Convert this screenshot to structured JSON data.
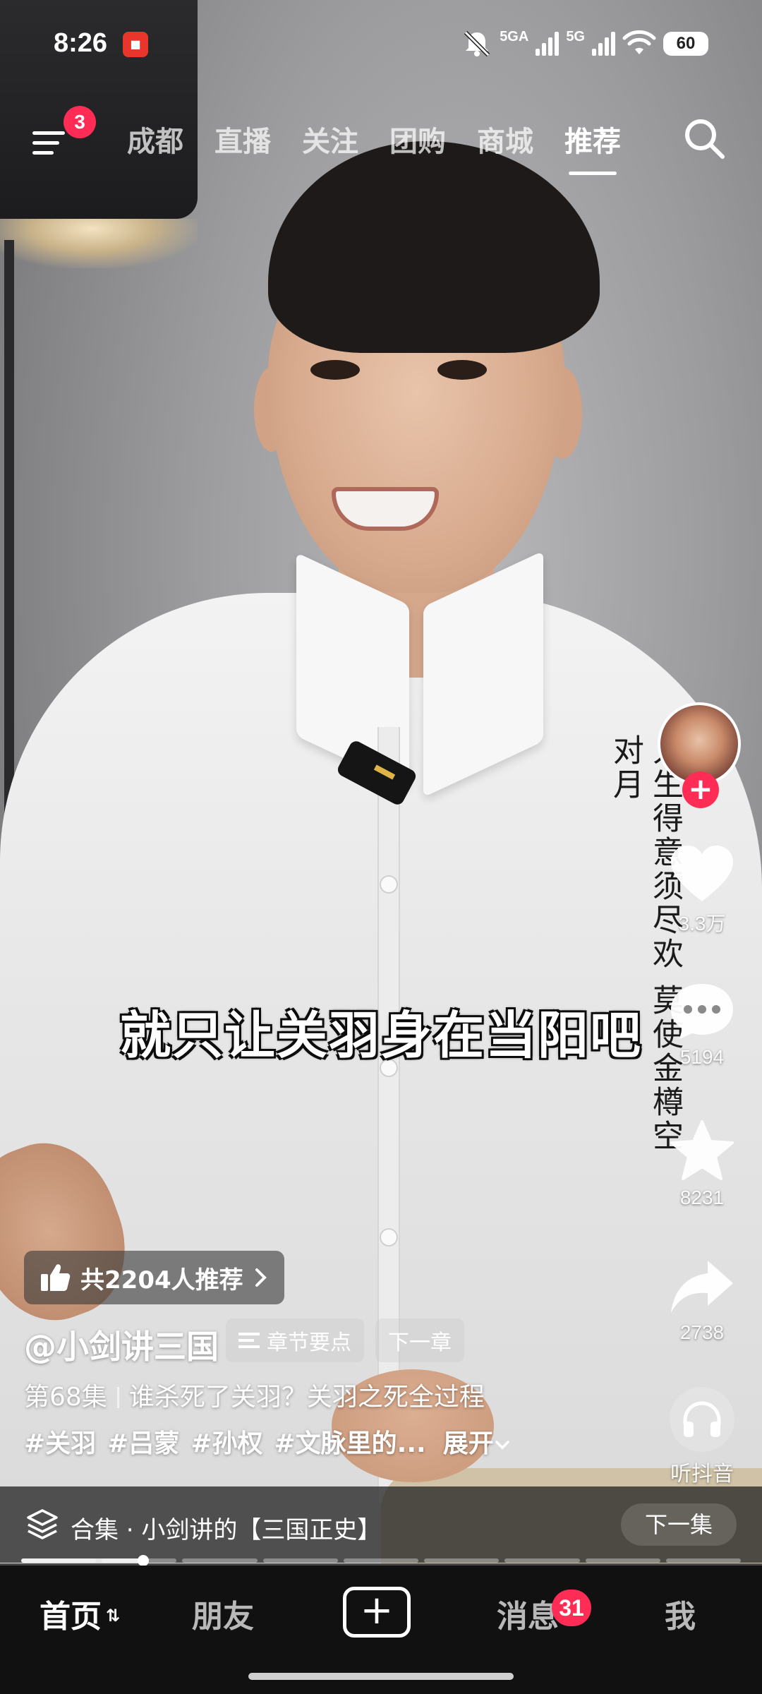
{
  "status_bar": {
    "time": "8:26",
    "network_1": "5GA",
    "network_2": "5G",
    "battery": "60"
  },
  "top_nav": {
    "menu_badge": "3",
    "tabs": [
      "成都",
      "直播",
      "关注",
      "团购",
      "商城",
      "推荐"
    ],
    "active_tab": "推荐"
  },
  "video": {
    "subtitle": "就只让关羽身在当阳吧",
    "shirt_calligraphy": "人生得意须尽欢 莫使金樽空对月"
  },
  "actions": {
    "likes": "3.3万",
    "comments": "5194",
    "favorites": "8231",
    "shares": "2738",
    "listen_label": "听抖音"
  },
  "info": {
    "recommend_chip": "共2204人推荐",
    "author": "@小剑讲三国",
    "chapter_points": "章节要点",
    "next_chapter": "下一章",
    "episode": "第68集",
    "episode_title": "谁杀死了关羽？关羽之死全过程",
    "hashtags": [
      "#关羽",
      "#吕蒙",
      "#孙权",
      "#文脉里的..."
    ],
    "expand": "展开"
  },
  "collection": {
    "title": "合集 · 小剑讲的【三国正史】",
    "next_episode": "下一集"
  },
  "progress": {
    "segments": 9,
    "played_fraction": 0.17
  },
  "tab_bar": {
    "home": "首页",
    "friends": "朋友",
    "create": "+",
    "messages": "消息",
    "messages_badge": "31",
    "me": "我"
  },
  "colors": {
    "accent": "#ff2c55",
    "tab_bar_bg": "#111111"
  }
}
